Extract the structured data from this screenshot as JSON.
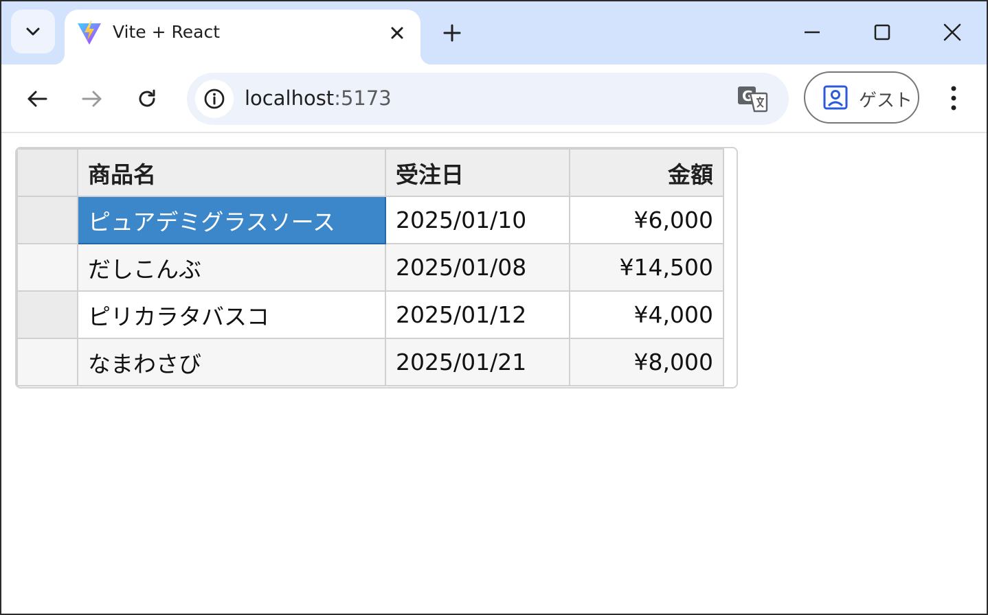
{
  "browser": {
    "tab": {
      "title": "Vite + React"
    },
    "address_bar": {
      "host": "localhost",
      "port": ":5173"
    },
    "profile": {
      "label": "ゲスト"
    },
    "icons": {
      "tab_search": "chevron-down-icon",
      "favicon": "vite-logo-icon",
      "close": "close-icon",
      "new_tab": "plus-icon",
      "minimize": "minimize-icon",
      "maximize": "maximize-icon",
      "window_close": "close-icon",
      "back": "arrow-left-icon",
      "forward": "arrow-right-icon",
      "reload": "reload-icon",
      "site_info": "info-icon",
      "translate": "translate-icon",
      "profile": "person-badge-icon",
      "menu": "more-vertical-icon"
    },
    "colors": {
      "tabstrip": "#d3e3fd",
      "omnibox": "#edf2fb",
      "selection": "#3c87c9"
    }
  },
  "grid": {
    "headers": [
      "",
      "商品名",
      "受注日",
      "金額"
    ],
    "rows": [
      [
        "",
        "ピュアデミグラスソース",
        "2025/01/10",
        "¥6,000"
      ],
      [
        "",
        "だしこんぶ",
        "2025/01/08",
        "¥14,500"
      ],
      [
        "",
        "ピリカラタバスコ",
        "2025/01/12",
        "¥4,000"
      ],
      [
        "",
        "なまわさび",
        "2025/01/21",
        "¥8,000"
      ]
    ],
    "selected_cell": "ピュアデミグラスソース"
  }
}
